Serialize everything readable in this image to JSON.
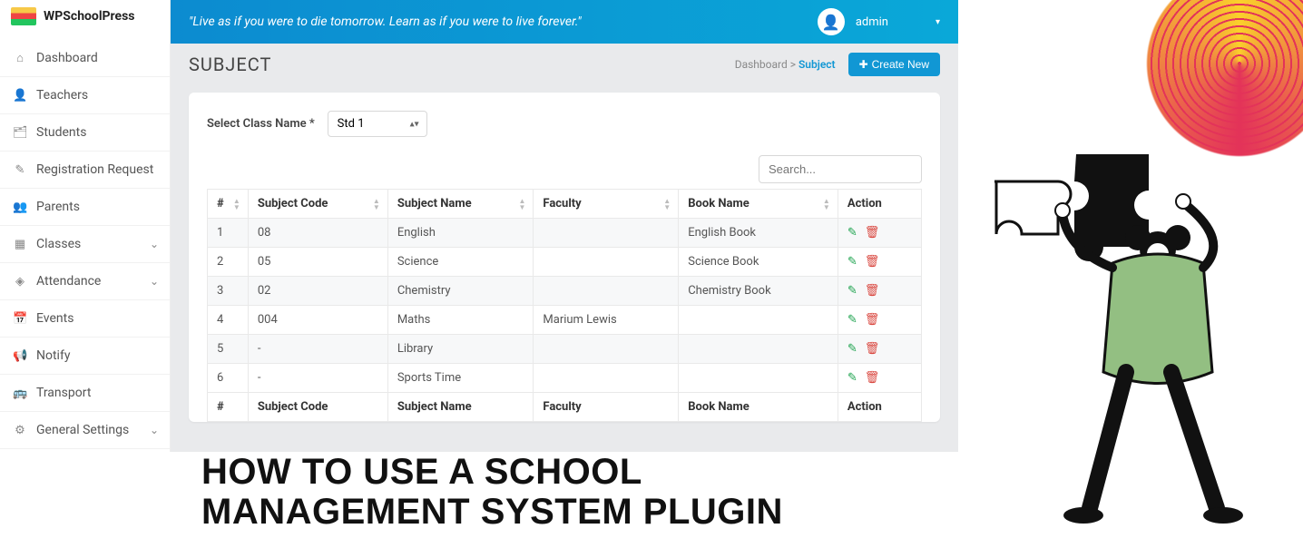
{
  "brand": {
    "name": "WPSchoolPress"
  },
  "sidebar": {
    "items": [
      {
        "label": "Dashboard",
        "icon": "⌂",
        "name": "sidebar-item-dashboard"
      },
      {
        "label": "Teachers",
        "icon": "👤",
        "name": "sidebar-item-teachers"
      },
      {
        "label": "Students",
        "icon": "🗂",
        "name": "sidebar-item-students"
      },
      {
        "label": "Registration Request",
        "icon": "✎",
        "name": "sidebar-item-registration"
      },
      {
        "label": "Parents",
        "icon": "👥",
        "name": "sidebar-item-parents"
      },
      {
        "label": "Classes",
        "icon": "▦",
        "name": "sidebar-item-classes",
        "chevron": true
      },
      {
        "label": "Attendance",
        "icon": "◈",
        "name": "sidebar-item-attendance",
        "chevron": true
      },
      {
        "label": "Events",
        "icon": "📅",
        "name": "sidebar-item-events"
      },
      {
        "label": "Notify",
        "icon": "📢",
        "name": "sidebar-item-notify"
      },
      {
        "label": "Transport",
        "icon": "🚌",
        "name": "sidebar-item-transport"
      },
      {
        "label": "General Settings",
        "icon": "⚙",
        "name": "sidebar-item-settings",
        "chevron": true
      }
    ]
  },
  "topbar": {
    "quote": "\"Live as if you were to die tomorrow. Learn as if you were to live forever.\"",
    "username": "admin"
  },
  "page": {
    "title": "SUBJECT",
    "breadcrumb": {
      "root": "Dashboard",
      "sep": ">",
      "current": "Subject"
    },
    "create_label": "Create New"
  },
  "filter": {
    "label": "Select Class Name *",
    "selected": "Std 1"
  },
  "search": {
    "placeholder": "Search..."
  },
  "table": {
    "headers": {
      "num": "#",
      "code": "Subject Code",
      "name": "Subject Name",
      "faculty": "Faculty",
      "book": "Book Name",
      "action": "Action"
    },
    "rows": [
      {
        "num": "1",
        "code": "08",
        "name": "English",
        "faculty": "",
        "book": "English Book"
      },
      {
        "num": "2",
        "code": "05",
        "name": "Science",
        "faculty": "",
        "book": "Science Book"
      },
      {
        "num": "3",
        "code": "02",
        "name": "Chemistry",
        "faculty": "",
        "book": "Chemistry Book"
      },
      {
        "num": "4",
        "code": "004",
        "name": "Maths",
        "faculty": "Marium Lewis",
        "book": ""
      },
      {
        "num": "5",
        "code": "-",
        "name": "Library",
        "faculty": "",
        "book": ""
      },
      {
        "num": "6",
        "code": "-",
        "name": "Sports Time",
        "faculty": "",
        "book": ""
      }
    ]
  },
  "article": {
    "headline_l1": "HOW TO USE A SCHOOL",
    "headline_l2": "MANAGEMENT SYSTEM PLUGIN"
  }
}
